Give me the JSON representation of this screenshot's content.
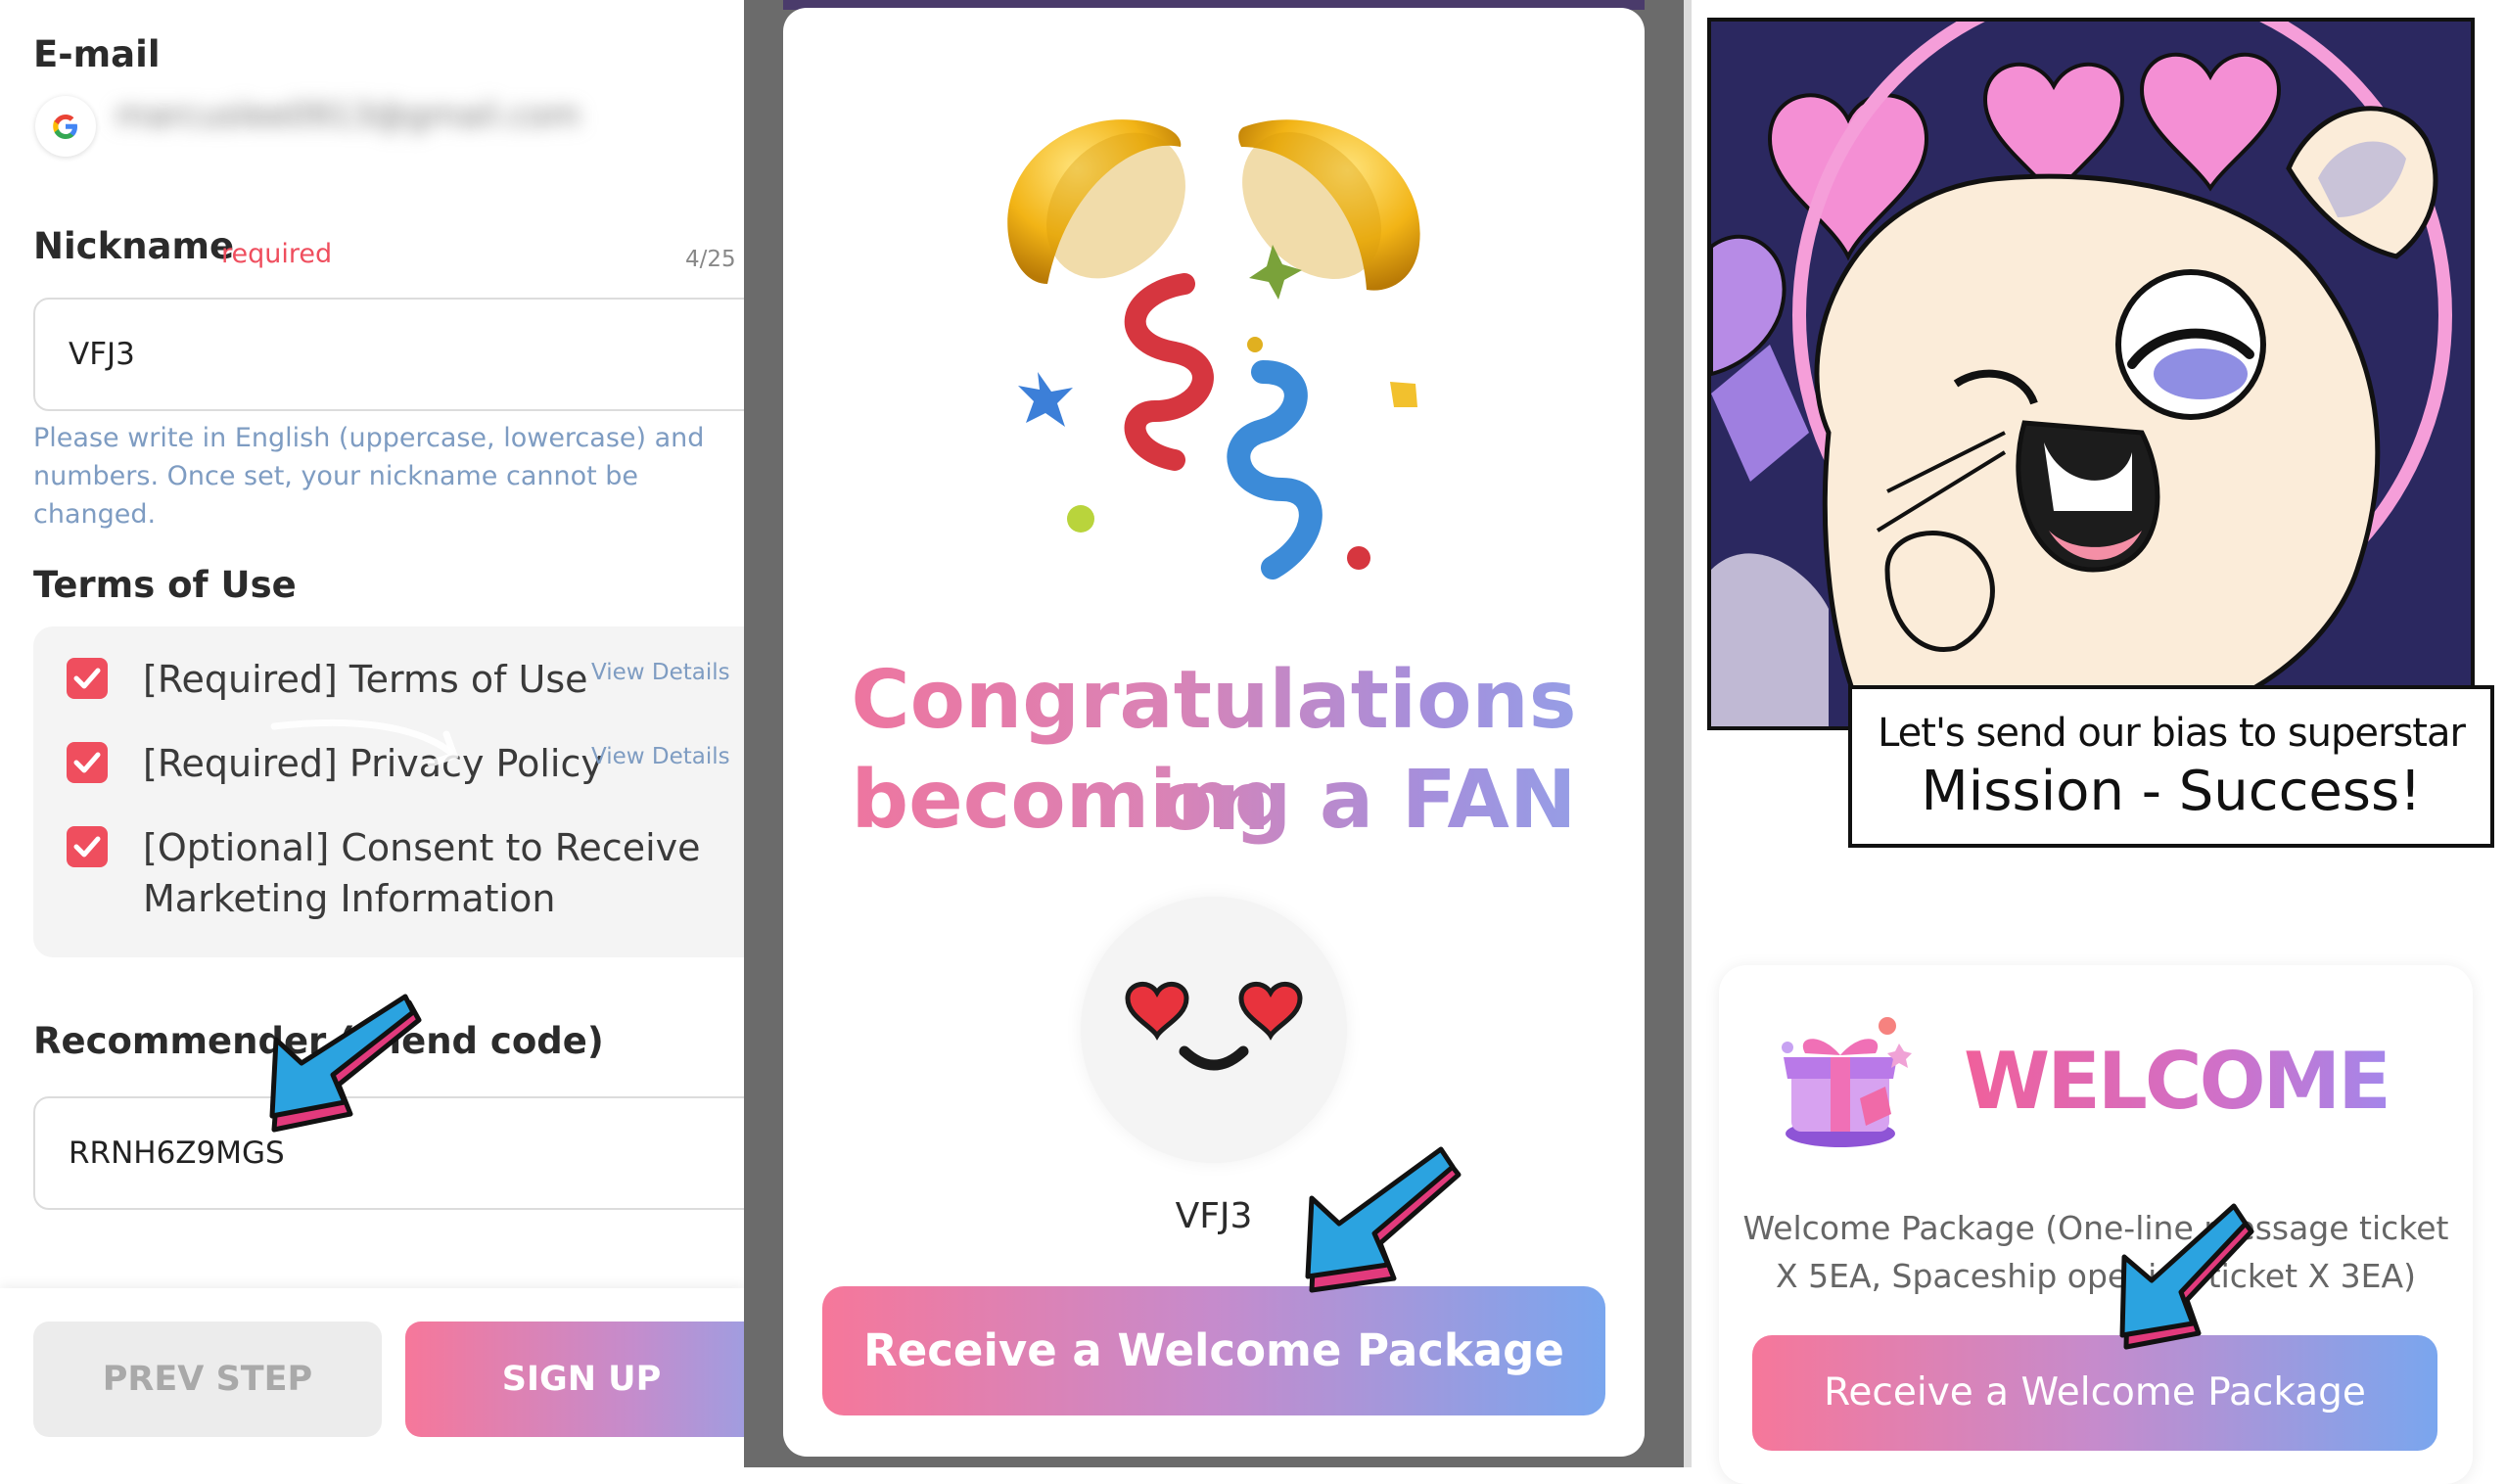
{
  "signup": {
    "email_label": "E-mail",
    "email_value": "marcuslee0913@gmail.com",
    "nickname_label": "Nickname",
    "nickname_required": "required",
    "nickname_count": "4/25",
    "nickname_value": "VFJ3",
    "help_text": "Please write in English (uppercase, lowercase) and numbers. Once set, your nickname cannot be changed.",
    "terms_title": "Terms of Use",
    "terms": [
      {
        "label": "[Required] Terms of Use",
        "link": "View Details",
        "checked": true
      },
      {
        "label": "[Required] Privacy Policy",
        "link": "View Details",
        "checked": true
      },
      {
        "label": "[Optional] Consent to Receive Marketing Information",
        "checked": true
      }
    ],
    "recommender_label": "Recommender (friend code)",
    "recommender_value": "RRNH6Z9MGS",
    "prev_button": "PREV STEP",
    "signup_button": "SIGN UP"
  },
  "modal": {
    "title_line1": "Congratulations on",
    "title_line2": "becoming a FAN",
    "nickname": "VFJ3",
    "button": "Receive a Welcome Package"
  },
  "welcome": {
    "caption_line1": "Let's send our bias to superstar",
    "caption_line2": "Mission - Success!",
    "title": "WELCOME",
    "description": "Welcome Package (One-line message ticket X 5EA, Spaceship opening ticket X 3EA)",
    "button": "Receive a Welcome Package"
  },
  "colors": {
    "accent_pink": "#f6779a",
    "accent_blue": "#7aa6ee",
    "checkbox_red": "#ef4e5e",
    "help_blue": "#7e9cc2",
    "arrow_blue": "#2ba3e0",
    "arrow_pink": "#e23a7c"
  }
}
